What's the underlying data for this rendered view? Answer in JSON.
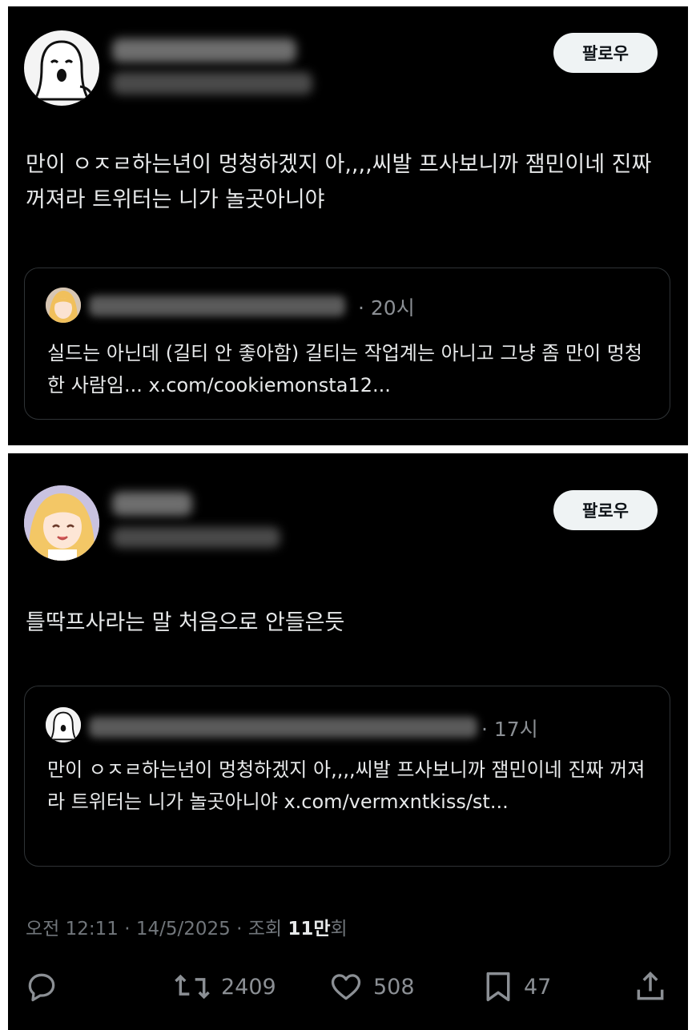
{
  "post1": {
    "follow_label": "팔로우",
    "text": "만이 ㅇㅈㄹ하는년이 멍청하겠지 아,,,,씨발 프사보니까 잼민이네 진짜 꺼져라 트위터는 니가 놀곳아니야",
    "quote": {
      "time": "· 20시",
      "text": "실드는 아닌데 (길티 안 좋아함) 길티는 작업계는 아니고 그냥 좀 만이 멍청한 사람임... x.com/cookiemonsta12..."
    }
  },
  "post2": {
    "follow_label": "팔로우",
    "text": "틀딱프사라는 말 처음으로 안들은듯",
    "quote": {
      "time": "· 17시",
      "text": "만이 ㅇㅈㄹ하는년이 멍청하겠지 아,,,,씨발 프사보니까 잼민이네 진짜 꺼져라 트위터는 니가 놀곳아니야 x.com/vermxntkiss/st..."
    },
    "meta": {
      "timestamp": "오전 12:11 · 14/5/2025 · 조회 ",
      "views_number": "11만",
      "views_suffix": "회"
    },
    "actions": {
      "retweets": "2409",
      "likes": "508",
      "bookmarks": "47"
    }
  },
  "colors": {
    "background": "#000000",
    "text": "#e7e9ea",
    "muted": "#71767b",
    "button_bg": "#eff3f4",
    "border": "#2f3336"
  },
  "icons": [
    "reply-icon",
    "retweet-icon",
    "like-icon",
    "bookmark-icon",
    "share-icon"
  ]
}
